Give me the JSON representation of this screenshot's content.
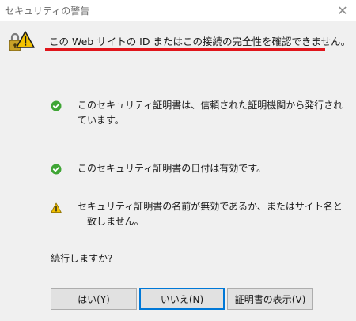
{
  "window": {
    "title": "セキュリティの警告",
    "close_glyph": "✕"
  },
  "header": {
    "message": "この Web サイトの ID またはこの接続の完全性を確認できません。",
    "icon": "warning-lock-icon",
    "underline_color": "#e0151b"
  },
  "checks": [
    {
      "status": "ok",
      "icon": "check-circle-icon",
      "text": "このセキュリティ証明書は、信頼された証明機関から発行されています。"
    },
    {
      "status": "ok",
      "icon": "check-circle-icon",
      "text": "このセキュリティ証明書の日付は有効です。"
    },
    {
      "status": "warning",
      "icon": "warning-triangle-icon",
      "text": "セキュリティ証明書の名前が無効であるか、またはサイト名と一致しません。"
    }
  ],
  "prompt": "続行しますか?",
  "buttons": {
    "yes": "はい(Y)",
    "no": "いいえ(N)",
    "view_cert": "証明書の表示(V)"
  },
  "colors": {
    "ok_green": "#3fa535",
    "warning_yellow": "#f2c100",
    "focus_blue": "#0078d7"
  }
}
